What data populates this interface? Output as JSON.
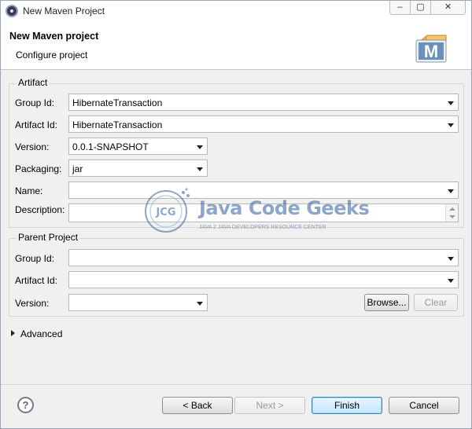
{
  "window": {
    "title": "New Maven Project",
    "controls": {
      "minimize": "‒",
      "maximize": "▢",
      "close": "✕"
    }
  },
  "header": {
    "title": "New Maven project",
    "subtitle": "Configure project",
    "logo_letter": "M"
  },
  "artifact": {
    "legend": "Artifact",
    "group_id_label": "Group Id:",
    "group_id_value": "HibernateTransaction",
    "artifact_id_label": "Artifact Id:",
    "artifact_id_value": "HibernateTransaction",
    "version_label": "Version:",
    "version_value": "0.0.1-SNAPSHOT",
    "packaging_label": "Packaging:",
    "packaging_value": "jar",
    "name_label": "Name:",
    "name_value": "",
    "description_label": "Description:",
    "description_value": ""
  },
  "parent": {
    "legend": "Parent Project",
    "group_id_label": "Group Id:",
    "group_id_value": "",
    "artifact_id_label": "Artifact Id:",
    "artifact_id_value": "",
    "version_label": "Version:",
    "version_value": "",
    "browse_label": "Browse...",
    "clear_label": "Clear"
  },
  "advanced": {
    "label": "Advanced"
  },
  "footer": {
    "help_glyph": "?",
    "back_label": "< Back",
    "next_label": "Next >",
    "finish_label": "Finish",
    "cancel_label": "Cancel"
  },
  "watermark": {
    "logo_text": "JCG",
    "main_text": "Java Code Geeks",
    "sub_text": "JAVA 2 JAVA DEVELOPERS RESOURCE CENTER"
  },
  "colors": {
    "dialog_bg": "#f0f0f0",
    "header_bg": "#ffffff",
    "default_button_border": "#3c7fb1",
    "watermark_blue": "#2f5f9d"
  }
}
